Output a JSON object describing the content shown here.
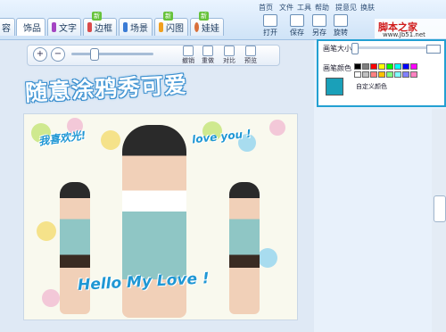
{
  "menu": {
    "items": [
      "首页",
      "文件",
      "工具",
      "帮助",
      "提意见",
      "换肤"
    ]
  },
  "tabs": [
    {
      "label": "容",
      "icon": "beauty-icon",
      "color": "#e86a8a",
      "badge": ""
    },
    {
      "label": "饰品",
      "icon": "heart-icon",
      "color": "#e23b4e",
      "badge": ""
    },
    {
      "label": "文字",
      "icon": "text-icon",
      "color": "#a445c2",
      "badge": ""
    },
    {
      "label": "边框",
      "icon": "frame-icon",
      "color": "#d94b4b",
      "badge": "新"
    },
    {
      "label": "场景",
      "icon": "scene-icon",
      "color": "#3a7bd5",
      "badge": ""
    },
    {
      "label": "闪图",
      "icon": "flash-icon",
      "color": "#f0a020",
      "badge": "新"
    },
    {
      "label": "娃娃",
      "icon": "doll-icon",
      "color": "#d9703a",
      "badge": "新"
    }
  ],
  "toolbar": {
    "buttons": [
      {
        "label": "打开",
        "icon": "open-icon"
      },
      {
        "label": "保存",
        "icon": "save-icon"
      },
      {
        "label": "另存",
        "icon": "save-as-icon"
      },
      {
        "label": "旋转",
        "icon": "rotate-icon"
      }
    ]
  },
  "toolstrip": {
    "zoom_in": "+",
    "zoom_out": "−",
    "buttons": [
      "撤销",
      "重做",
      "对比",
      "预览"
    ]
  },
  "canvas": {
    "headline": "随意涂鸦秀可爱",
    "text_1": "我喜欢光!",
    "text_2": "love you !",
    "text_3": "Hello My Love !"
  },
  "panel": {
    "brush_size_label": "画笔大小",
    "brush_color_label": "画笔颜色",
    "custom_color_label": "自定义颜色",
    "selected_color": "#1aa0b9",
    "brush_level": 0.0,
    "swatches": [
      "#000000",
      "#7f7f7f",
      "#ff0000",
      "#ffff00",
      "#00ff00",
      "#00ffff",
      "#0000ff",
      "#ff00ff",
      "#ffffff",
      "#c0c0c0",
      "#ff8080",
      "#ffc000",
      "#80ff80",
      "#80ffff",
      "#8080ff",
      "#ff80c0"
    ]
  },
  "watermark": {
    "title": "脚本之家",
    "url": "www.Jb51.net"
  }
}
